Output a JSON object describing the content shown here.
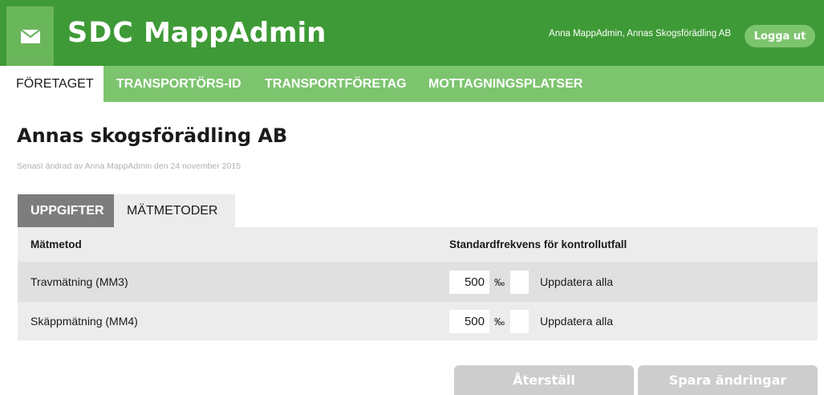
{
  "header": {
    "logo_text": "SDC",
    "app_name": "MappAdmin",
    "user_info": "Anna MappAdmin, Annas Skogsförädling AB",
    "logout_label": "Logga ut",
    "icons": {
      "mail": "mail-icon"
    },
    "colors": {
      "header_bg": "#3e9a36",
      "nav_bg": "#7dc46f",
      "mail_box_bg": "#6ab65b"
    }
  },
  "nav": {
    "items": [
      {
        "label": "FÖRETAGET",
        "active": true
      },
      {
        "label": "TRANSPORTÖRS-ID",
        "active": false
      },
      {
        "label": "TRANSPORTFÖRETAG",
        "active": false
      },
      {
        "label": "MOTTAGNINGSPLATSER",
        "active": false
      }
    ]
  },
  "page": {
    "title": "Annas skogsförädling AB",
    "modified": "Senast ändrad av Anna MappAdmin den 24 november 2015"
  },
  "tabs": [
    {
      "label": "UPPGIFTER",
      "active": true
    },
    {
      "label": "MÄTMETODER",
      "active": false
    }
  ],
  "table": {
    "columns": [
      "Mätmetod",
      "Standardfrekvens för kontrollutfall"
    ],
    "rows": [
      {
        "method": "Travmätning (MM3)",
        "frequency": "500",
        "unit": "‰",
        "update_label": "Uppdatera alla",
        "checked": false
      },
      {
        "method": "Skäppmätning (MM4)",
        "frequency": "500",
        "unit": "‰",
        "update_label": "Uppdatera alla",
        "checked": false
      }
    ]
  },
  "actions": {
    "reset_label": "Återställ",
    "save_label": "Spara ändringar"
  }
}
